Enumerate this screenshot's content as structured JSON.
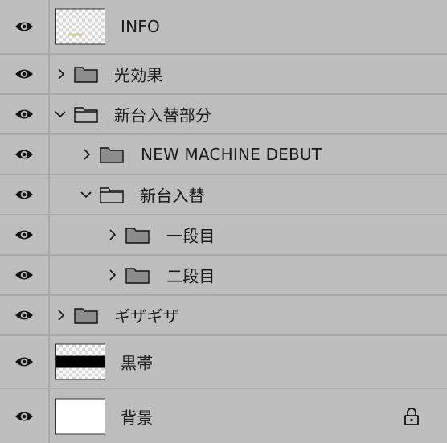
{
  "layers": [
    {
      "label": "INFO",
      "kind": "thumb-info"
    },
    {
      "label": "光効果",
      "kind": "folder",
      "expanded": false,
      "indent": 0
    },
    {
      "label": "新台入替部分",
      "kind": "folder",
      "expanded": true,
      "indent": 0
    },
    {
      "label": "NEW MACHINE DEBUT",
      "kind": "folder",
      "expanded": false,
      "indent": 1
    },
    {
      "label": "新台入替",
      "kind": "folder",
      "expanded": true,
      "indent": 1
    },
    {
      "label": "一段目",
      "kind": "folder",
      "expanded": false,
      "indent": 2
    },
    {
      "label": "二段目",
      "kind": "folder",
      "expanded": false,
      "indent": 2
    },
    {
      "label": "ギザギザ",
      "kind": "folder",
      "expanded": false,
      "indent": 0
    },
    {
      "label": "黒帯",
      "kind": "thumb-bar"
    },
    {
      "label": "背景",
      "kind": "thumb-plain",
      "locked": true
    }
  ],
  "icons": {
    "visibility": "eye-icon",
    "folder": "folder-icon",
    "expand": "chevron-right-icon",
    "collapse": "chevron-down-icon",
    "lock": "lock-icon"
  }
}
